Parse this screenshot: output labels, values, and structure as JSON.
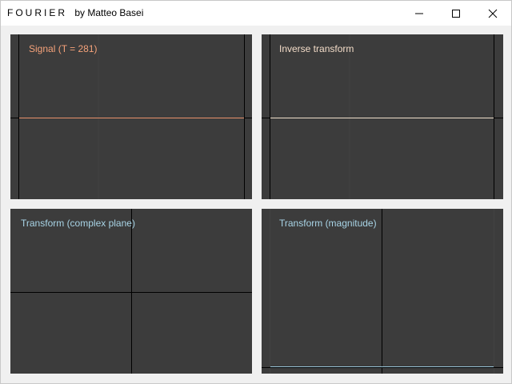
{
  "window": {
    "app_name": "FOURIER",
    "author": "by Matteo Basei",
    "controls": {
      "minimize_icon": "minimize-icon",
      "maximize_icon": "maximize-icon",
      "close_icon": "close-icon"
    }
  },
  "panels": {
    "signal": {
      "label": "Signal (T = 281)",
      "label_color": "#f5a27a",
      "trace_color": "#e8906a"
    },
    "inverse": {
      "label": "Inverse transform",
      "label_color": "#f3dcc8",
      "trace_color": "#f0e0cc"
    },
    "complex": {
      "label": "Transform (complex plane)",
      "label_color": "#a8d4e6"
    },
    "magnitude": {
      "label": "Transform (magnitude)",
      "label_color": "#a8d4e6",
      "trace_color": "#9cc8dc"
    }
  },
  "colors": {
    "panel_bg": "#3c3c3c",
    "axis": "#000000",
    "grid": "#404040"
  }
}
